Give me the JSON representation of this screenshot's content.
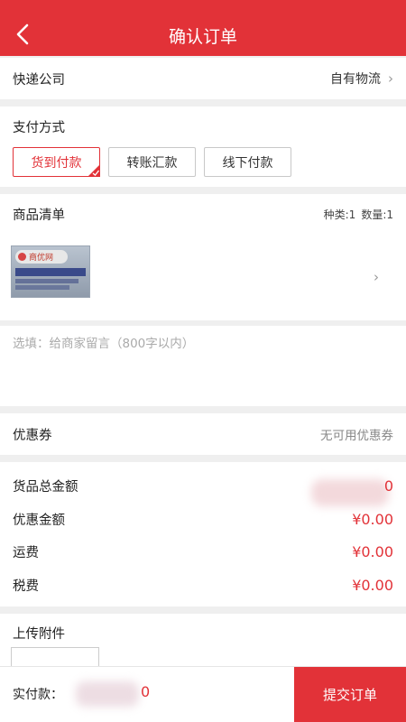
{
  "header": {
    "title": "确认订单"
  },
  "express": {
    "label": "快递公司",
    "value": "自有物流"
  },
  "payment": {
    "title": "支付方式",
    "options": [
      {
        "label": "货到付款",
        "selected": true
      },
      {
        "label": "转账汇款",
        "selected": false
      },
      {
        "label": "线下付款",
        "selected": false
      }
    ]
  },
  "goods": {
    "title": "商品清单",
    "kinds": "种类:1",
    "quantity": "数量:1",
    "thumb_logo": "商优网"
  },
  "message": {
    "placeholder": "选填：给商家留言（800字以内）"
  },
  "coupon": {
    "label": "优惠券",
    "value": "无可用优惠券"
  },
  "amounts": [
    {
      "label": "货品总金额",
      "value": "0"
    },
    {
      "label": "优惠金额",
      "value": "¥0.00"
    },
    {
      "label": "运费",
      "value": "¥0.00"
    },
    {
      "label": "税费",
      "value": "¥0.00"
    }
  ],
  "attachment": {
    "title": "上传附件"
  },
  "footer": {
    "pay_label": "实付款：",
    "pay_amount": "0",
    "submit_label": "提交订单"
  },
  "colors": {
    "accent": "#e23238"
  }
}
